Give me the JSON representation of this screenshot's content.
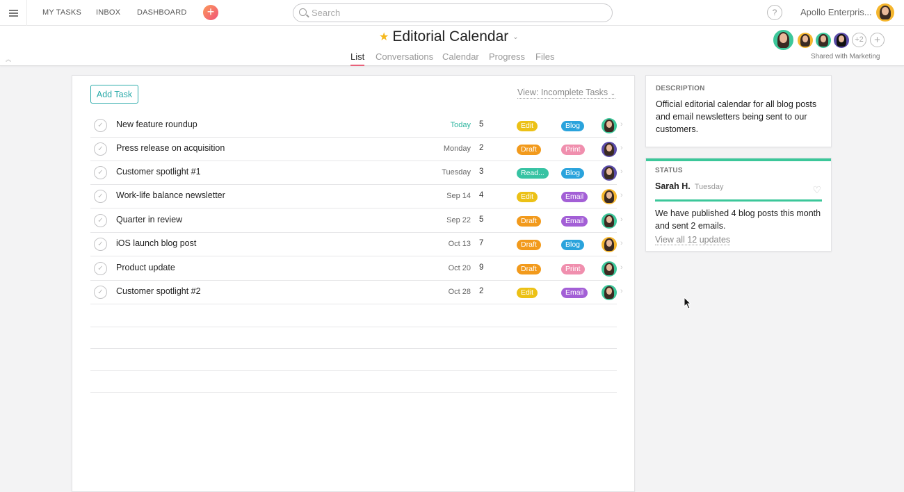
{
  "topbar": {
    "nav": [
      "MY TASKS",
      "INBOX",
      "DASHBOARD"
    ],
    "search_placeholder": "Search",
    "help_label": "?",
    "org_name": "Apollo Enterpris..."
  },
  "project": {
    "title": "Editorial Calendar",
    "starred": true,
    "tabs": [
      "List",
      "Conversations",
      "Calendar",
      "Progress",
      "Files"
    ],
    "active_tab": "List",
    "members_extra": "+2",
    "add_member": "+",
    "shared_label": "Shared with Marketing"
  },
  "list": {
    "add_task_label": "Add Task",
    "view_label": "View: Incomplete Tasks",
    "tasks": [
      {
        "name": "New feature roundup",
        "due": "Today",
        "num": "5",
        "stage": "Edit",
        "channel": "Blog",
        "assignee": "teal"
      },
      {
        "name": "Press release on acquisition",
        "due": "Monday",
        "num": "2",
        "stage": "Draft",
        "channel": "Print",
        "assignee": "purple"
      },
      {
        "name": "Customer spotlight #1",
        "due": "Tuesday",
        "num": "3",
        "stage": "Read...",
        "channel": "Blog",
        "assignee": "purple"
      },
      {
        "name": "Work-life balance newsletter",
        "due": "Sep 14",
        "num": "4",
        "stage": "Edit",
        "channel": "Email",
        "assignee": "yellow"
      },
      {
        "name": "Quarter in review",
        "due": "Sep 22",
        "num": "5",
        "stage": "Draft",
        "channel": "Email",
        "assignee": "teal"
      },
      {
        "name": "iOS launch blog post",
        "due": "Oct 13",
        "num": "7",
        "stage": "Draft",
        "channel": "Blog",
        "assignee": "yellow"
      },
      {
        "name": "Product update",
        "due": "Oct 20",
        "num": "9",
        "stage": "Draft",
        "channel": "Print",
        "assignee": "teal"
      },
      {
        "name": "Customer spotlight #2",
        "due": "Oct 28",
        "num": "2",
        "stage": "Edit",
        "channel": "Email",
        "assignee": "teal"
      }
    ]
  },
  "colors": {
    "Edit": "#ecc116",
    "Draft": "#f29a1c",
    "Read...": "#37c3a3",
    "Blog": "#2aa3dc",
    "Print": "#f08fae",
    "Email": "#a35fd6",
    "today": "#2fb6a0",
    "accent": "#2aaaa9",
    "status": "#3cc79a",
    "teal": "#3cc79a",
    "purple": "#5a4ba8",
    "yellow": "#f5b62e"
  },
  "description": {
    "label": "DESCRIPTION",
    "text": "Official editorial calendar for all blog posts and email newsletters being sent to our customers."
  },
  "status": {
    "label": "STATUS",
    "author": "Sarah H.",
    "date": "Tuesday",
    "text": "We have published 4 blog posts this month and sent 2 emails.",
    "link": "View all 12 updates"
  }
}
